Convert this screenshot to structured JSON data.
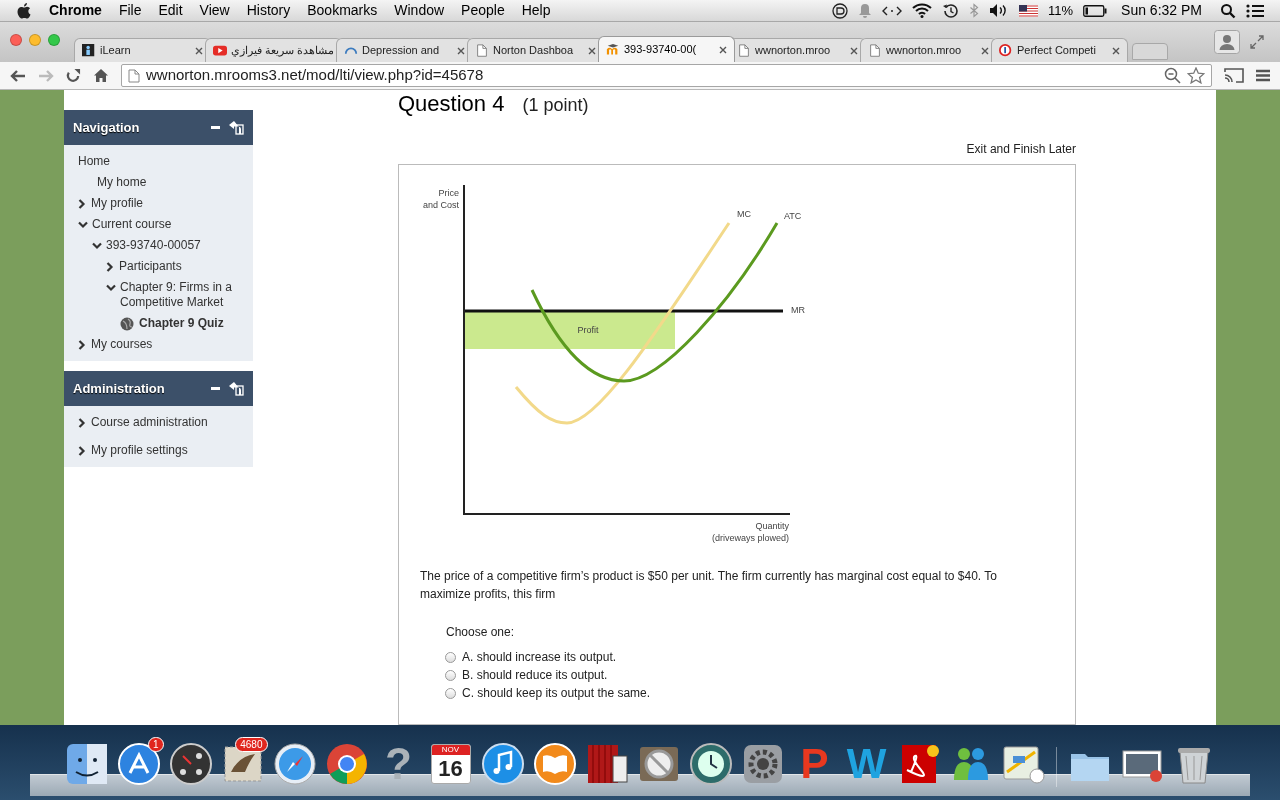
{
  "menu_bar": {
    "app": "Chrome",
    "menus": [
      "File",
      "Edit",
      "View",
      "History",
      "Bookmarks",
      "Window",
      "People",
      "Help"
    ],
    "battery": "11%",
    "clock": "Sun 6:32 PM"
  },
  "tabs": [
    {
      "title": "iLearn",
      "kind": "person",
      "selected": false
    },
    {
      "title": "مشاهدة سريعة فيرازي",
      "kind": "play",
      "selected": false
    },
    {
      "title": "Depression and",
      "kind": "spinner",
      "selected": false
    },
    {
      "title": "Norton Dashboa",
      "kind": "page",
      "selected": false
    },
    {
      "title": "393-93740-00(",
      "kind": "hat",
      "selected": true
    },
    {
      "title": "wwnorton.mroo",
      "kind": "page",
      "selected": false
    },
    {
      "title": "wwnorton.mroo",
      "kind": "page",
      "selected": false
    },
    {
      "title": "Perfect Competi",
      "kind": "ring",
      "selected": false
    }
  ],
  "address_bar": {
    "url": "wwnorton.mrooms3.net/mod/lti/view.php?id=45678"
  },
  "sidebar": {
    "blocks": [
      {
        "title": "Navigation",
        "items": [
          {
            "label": "Home",
            "selected": false,
            "children": [
              {
                "label": "My home",
                "selected": false
              },
              {
                "label": "My profile",
                "expanded": false,
                "selected": false
              },
              {
                "label": "Current course",
                "expanded": true,
                "selected": false,
                "children": [
                  {
                    "label": "393-93740-00057",
                    "expanded": true,
                    "selected": false,
                    "children": [
                      {
                        "label": "Participants",
                        "expanded": false,
                        "selected": false
                      },
                      {
                        "label": "Chapter 9: Firms in a Competitive Market",
                        "expanded": true,
                        "selected": false,
                        "children": [
                          {
                            "label": "Chapter 9 Quiz",
                            "kind": "quiz",
                            "selected": true
                          }
                        ]
                      }
                    ]
                  }
                ]
              },
              {
                "label": "My courses",
                "expanded": false,
                "selected": false
              }
            ]
          }
        ]
      },
      {
        "title": "Administration",
        "items": [
          {
            "label": "Course administration",
            "expanded": false,
            "selected": false
          },
          {
            "label": "My profile settings",
            "expanded": false,
            "selected": false
          }
        ]
      }
    ]
  },
  "question": {
    "title": "Question 4",
    "points": "(1 point)",
    "exit_link": "Exit and Finish Later",
    "graph": {
      "y_axis_label": [
        "Price",
        "and Cost"
      ],
      "x_axis_label": [
        "Quantity",
        "(driveways plowed)"
      ],
      "revenue_label": "MR",
      "area_label": "Profit",
      "curves": [
        {
          "label": "MC",
          "kind": "mc",
          "color": "#f2d98a"
        },
        {
          "label": "ATC",
          "kind": "atc",
          "color": "#5b9a1f"
        }
      ]
    },
    "text": "The price of a competitive firm’s product is $50 per unit. The firm currently has marginal cost equal to $40. To maximize profits, this firm",
    "prompt": "Choose one:",
    "options": [
      {
        "label": "A. should increase its output.",
        "selected": false
      },
      {
        "label": "B. should reduce its output.",
        "selected": false
      },
      {
        "label": "C. should keep its output the same.",
        "selected": false
      }
    ]
  },
  "dock": {
    "items": [
      {
        "kind": "finder"
      },
      {
        "kind": "store",
        "badge": "1"
      },
      {
        "kind": "gauge"
      },
      {
        "kind": "stamp",
        "badge": "4680"
      },
      {
        "kind": "compass"
      },
      {
        "kind": "chrome"
      },
      {
        "kind": "question",
        "glyph": "?"
      },
      {
        "kind": "calendar",
        "month": "NOV",
        "day": "16"
      },
      {
        "kind": "music"
      },
      {
        "kind": "book"
      },
      {
        "kind": "curtain"
      },
      {
        "kind": "prohibit"
      },
      {
        "kind": "clock"
      },
      {
        "kind": "gear"
      },
      {
        "kind": "letter",
        "glyph": "P",
        "color": "#e8381f"
      },
      {
        "kind": "letter",
        "glyph": "W",
        "color": "#1fa3e0"
      },
      {
        "kind": "document"
      },
      {
        "kind": "people"
      },
      {
        "kind": "map"
      },
      {
        "kind": "divider"
      },
      {
        "kind": "folder"
      },
      {
        "kind": "photos"
      },
      {
        "kind": "trash"
      }
    ]
  }
}
